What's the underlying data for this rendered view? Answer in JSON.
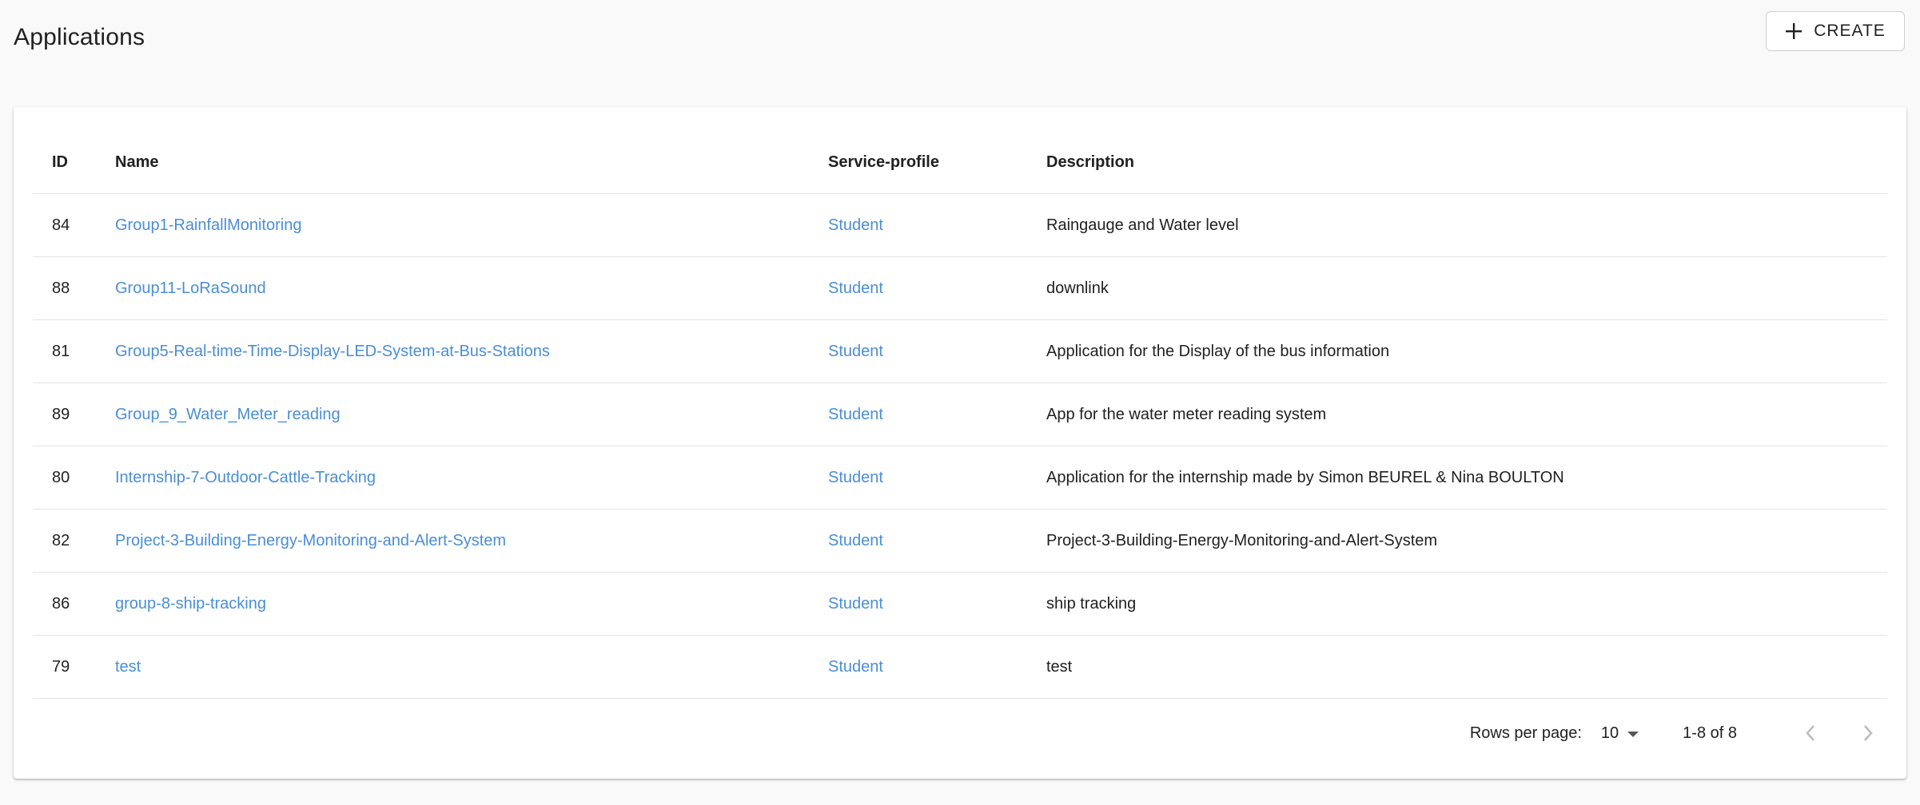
{
  "header": {
    "title": "Applications",
    "create_label": "CREATE"
  },
  "table": {
    "columns": {
      "id": "ID",
      "name": "Name",
      "service_profile": "Service-profile",
      "description": "Description"
    },
    "rows": [
      {
        "id": "84",
        "name": "Group1-RainfallMonitoring",
        "service_profile": "Student",
        "description": "Raingauge and Water level"
      },
      {
        "id": "88",
        "name": "Group11-LoRaSound",
        "service_profile": "Student",
        "description": "downlink"
      },
      {
        "id": "81",
        "name": "Group5-Real-time-Time-Display-LED-System-at-Bus-Stations",
        "service_profile": "Student",
        "description": "Application for the Display of the bus information"
      },
      {
        "id": "89",
        "name": "Group_9_Water_Meter_reading",
        "service_profile": "Student",
        "description": "App for the water meter reading system"
      },
      {
        "id": "80",
        "name": "Internship-7-Outdoor-Cattle-Tracking",
        "service_profile": "Student",
        "description": "Application for the internship made by Simon BEUREL & Nina BOULTON"
      },
      {
        "id": "82",
        "name": "Project-3-Building-Energy-Monitoring-and-Alert-System",
        "service_profile": "Student",
        "description": "Project-3-Building-Energy-Monitoring-and-Alert-System"
      },
      {
        "id": "86",
        "name": "group-8-ship-tracking",
        "service_profile": "Student",
        "description": "ship tracking"
      },
      {
        "id": "79",
        "name": "test",
        "service_profile": "Student",
        "description": "test"
      }
    ]
  },
  "pagination": {
    "rows_per_page_label": "Rows per page:",
    "rows_per_page_value": "10",
    "range_label": "1-8 of 8"
  },
  "colors": {
    "link": "#4a8ed6",
    "background": "#f9f9f9",
    "card": "#ffffff",
    "divider": "#e3e3e3"
  },
  "icons": {
    "create": "plus-icon",
    "rows_select": "caret-down-icon",
    "prev": "chevron-left-icon",
    "next": "chevron-right-icon"
  }
}
